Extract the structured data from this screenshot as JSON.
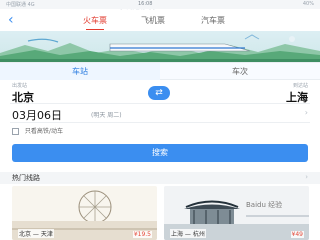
{
  "status_bar": {
    "carrier": "中国联通 4G",
    "time": "16:08",
    "battery": "40%",
    "hint": "0 ·人·叫·图·标 · 0 0"
  },
  "transport_tabs": [
    {
      "label": "火车票",
      "active": true
    },
    {
      "label": "飞机票",
      "active": false
    },
    {
      "label": "汽车票",
      "active": false
    }
  ],
  "search_modes": [
    {
      "label": "车站",
      "active": true
    },
    {
      "label": "车次",
      "active": false
    }
  ],
  "from_label": "出发站",
  "from_city": "北京",
  "to_label": "到达站",
  "to_city": "上海",
  "date": {
    "main": "03月06日",
    "sub": "(明天 周二)"
  },
  "filter": {
    "label": "只看高铁/动车",
    "checked": false
  },
  "search_button": "搜索",
  "section": {
    "title": "热门线路"
  },
  "routes": [
    {
      "name": "北京 — 天津",
      "price": "¥19.5"
    },
    {
      "name": "上海 — 杭州",
      "price": "¥49"
    }
  ],
  "watermark": "Baidu 经验",
  "colors": {
    "accent": "#3b8ef0",
    "active_tab": "#e23b2f",
    "price": "#e44a3a"
  }
}
